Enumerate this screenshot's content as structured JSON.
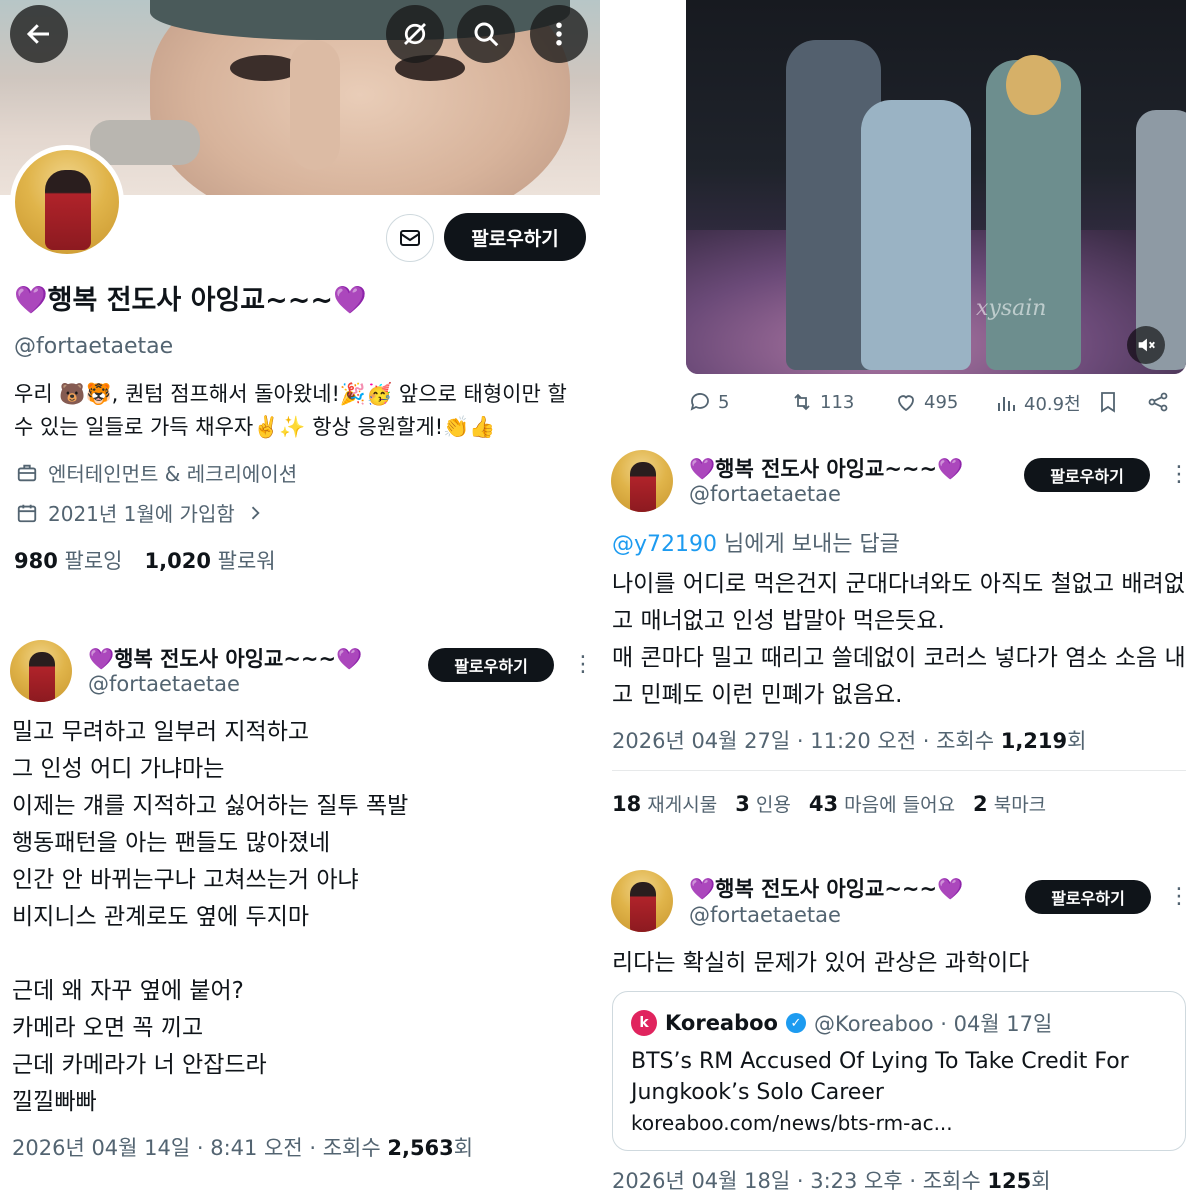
{
  "profile": {
    "display_name": "💜행복 전도사 아잉교~~~💜",
    "handle": "@fortaetaetae",
    "follow_label": "팔로우하기",
    "bio": "우리 🐻🐯, 퀀텀 점프해서 돌아왔네!🎉🥳 앞으로 태형이만 할 수 있는 일들로 가득 채우자✌️✨ 항상 응원할게!👏👍",
    "category": "엔터테인먼트 & 레크리에이션",
    "joined": "2021년 1월에 가입함",
    "following_count": "980",
    "following_label": "팔로잉",
    "followers_count": "1,020",
    "followers_label": "팔로워"
  },
  "tweet_left": {
    "display_name": "💜행복 전도사 아잉교~~~💜",
    "handle": "@fortaetaetae",
    "follow_label": "팔로우하기",
    "text": "밀고 무려하고 일부러 지적하고\n그 인성 어디 가냐마는\n이제는 걔를 지적하고 싫어하는  질투 폭발\n행동패턴을 아는 팬들도 많아졌네\n인간 안 바뀌는구나 고쳐쓰는거 아냐\n비지니스 관계로도 옆에 두지마\n\n근데 왜 자꾸 옆에 붙어?\n카메라 오면 꼭 끼고\n근데 카메라가 너 안잡드라\n낄낄빠빠",
    "timestamp": "2026년 04월 14일 · 8:41 오전 · 조회수 ",
    "views": "2,563",
    "views_suffix": "회"
  },
  "video_tweet": {
    "watermark": "xysain",
    "replies": "5",
    "retweets": "113",
    "likes": "495",
    "views": "40.9천"
  },
  "reply_tweet": {
    "display_name": "💜행복 전도사 아잉교~~~💜",
    "handle": "@fortaetaetae",
    "follow_label": "팔로우하기",
    "reply_to_user": "@y72190",
    "reply_to_suffix": " 님에게 보내는 답글",
    "text": "나이를 어디로 먹은건지  군대다녀와도 아직도 철없고 배려없고  매너없고 인성 밥말아 먹은듯요.\n매  콘마다 밀고 때리고 쓸데없이 코러스 넣다가 염소 소음 내고 민폐도 이런 민폐가 없음요.",
    "timestamp": "2026년 04월 27일 · 11:20 오전 · 조회수 ",
    "views": "1,219",
    "views_suffix": "회",
    "retweets": "18",
    "retweets_label": "재게시물",
    "quotes": "3",
    "quotes_label": "인용",
    "likes": "43",
    "likes_label": "마음에 들어요",
    "bookmarks": "2",
    "bookmarks_label": "북마크"
  },
  "quote_tweet": {
    "display_name": "💜행복 전도사 아잉교~~~💜",
    "handle": "@fortaetaetae",
    "follow_label": "팔로우하기",
    "text": "리다는  확실히 문제가 있어  관상은 과학이다",
    "quoted": {
      "source_name": "Koreaboo",
      "source_handle": "@Koreaboo · 04월 17일",
      "headline": "BTS’s RM Accused Of Lying To Take Credit For Jungkook’s Solo Career",
      "link": "koreaboo.com/news/bts-rm-ac..."
    },
    "timestamp": "2026년 04월 18일 · 3:23 오후 · 조회수 ",
    "views": "125",
    "views_suffix": "회"
  },
  "colors": {
    "accent": "#1d9bf0",
    "text": "#0f1419",
    "muted": "#536471",
    "heart": "#9b3fe0",
    "koreaboo": "#e0245e"
  },
  "icons": [
    "back-arrow-icon",
    "grok-icon",
    "search-icon",
    "more-vertical-icon",
    "mail-icon",
    "briefcase-icon",
    "calendar-icon",
    "chevron-right-icon",
    "reply-icon",
    "retweet-icon",
    "like-icon",
    "views-icon",
    "bookmark-icon",
    "share-icon",
    "mute-icon",
    "verified-icon"
  ]
}
